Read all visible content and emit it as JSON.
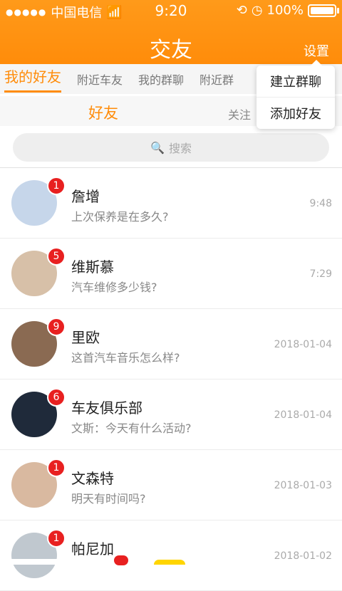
{
  "statusbar": {
    "dots": "●●●●●",
    "carrier": "中国电信",
    "time": "9:20",
    "battery": "100%"
  },
  "header": {
    "title": "交友",
    "settings": "设置"
  },
  "tabs": [
    "我的好友",
    "附近车友",
    "我的群聊",
    "附近群"
  ],
  "subtabs": {
    "friends": "好友",
    "follow": "关注"
  },
  "search": {
    "placeholder": "搜索"
  },
  "dropdown": [
    "建立群聊",
    "添加好友"
  ],
  "contacts": [
    {
      "badge": "1",
      "name": "詹增",
      "msg": "上次保养是在多久?",
      "time": "9:48",
      "avatarColor": "#c6d6ea"
    },
    {
      "badge": "5",
      "name": "维斯慕",
      "msg": "汽车维修多少钱?",
      "time": "7:29",
      "avatarColor": "#d7c0a8"
    },
    {
      "badge": "9",
      "name": "里欧",
      "msg": "这首汽车音乐怎么样?",
      "time": "2018-01-04",
      "avatarColor": "#8a6a52"
    },
    {
      "badge": "6",
      "name": "车友俱乐部",
      "msg": "文斯：今天有什么活动?",
      "time": "2018-01-04",
      "avatarColor": "#1f2a3a"
    },
    {
      "badge": "1",
      "name": "文森特",
      "msg": "明天有时间吗?",
      "time": "2018-01-03",
      "avatarColor": "#d9b9a0"
    },
    {
      "badge": "1",
      "name": "帕尼加",
      "msg": "",
      "time": "2018-01-02",
      "avatarColor": "#c0c8cf"
    }
  ]
}
